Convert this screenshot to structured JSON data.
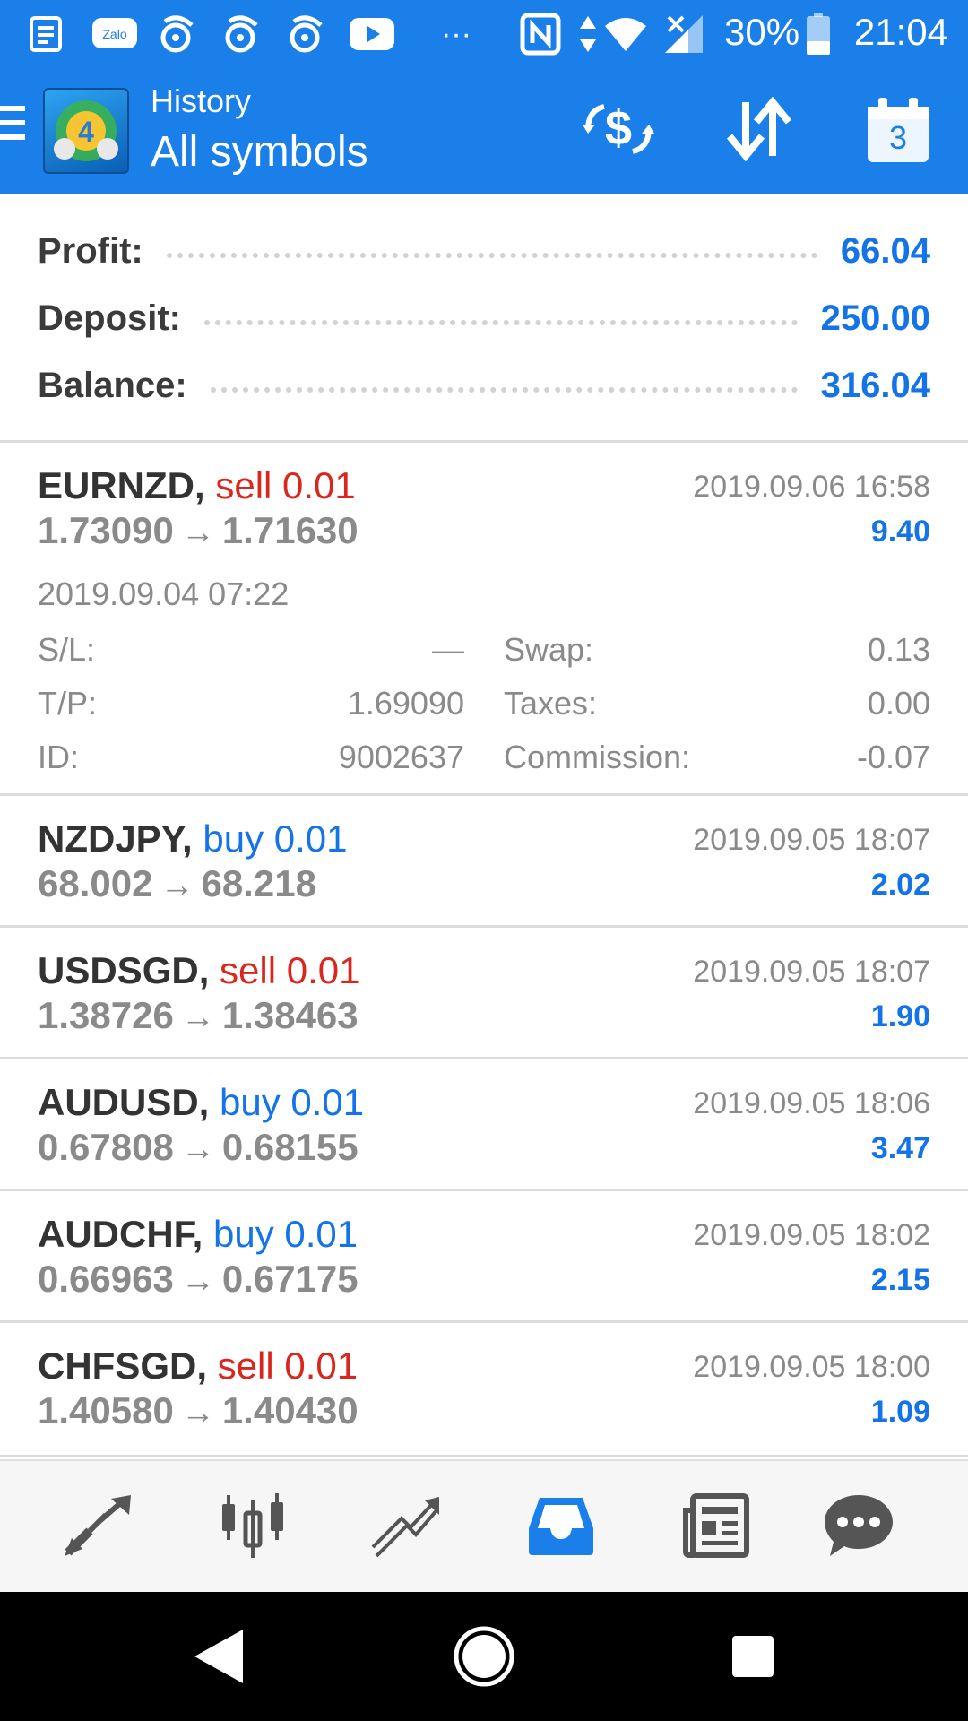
{
  "status_bar": {
    "battery_percent": "30%",
    "time": "21:04",
    "more": "···",
    "zalo": "Zalo"
  },
  "header": {
    "subtitle": "History",
    "title": "All symbols",
    "calendar_day": "3"
  },
  "summary": {
    "profit_label": "Profit:",
    "profit_value": "66.04",
    "deposit_label": "Deposit:",
    "deposit_value": "250.00",
    "balance_label": "Balance:",
    "balance_value": "316.04"
  },
  "trades": [
    {
      "symbol": "EURNZD,",
      "direction": "sell 0.01",
      "direction_type": "sell",
      "open_price": "1.73090",
      "close_price": "1.71630",
      "close_time": "2019.09.06 16:58",
      "profit": "9.40",
      "expanded": true,
      "open_time": "2019.09.04 07:22",
      "sl_label": "S/L:",
      "sl_value": "—",
      "tp_label": "T/P:",
      "tp_value": "1.69090",
      "id_label": "ID:",
      "id_value": "9002637",
      "swap_label": "Swap:",
      "swap_value": "0.13",
      "taxes_label": "Taxes:",
      "taxes_value": "0.00",
      "commission_label": "Commission:",
      "commission_value": "-0.07"
    },
    {
      "symbol": "NZDJPY,",
      "direction": "buy 0.01",
      "direction_type": "buy",
      "open_price": "68.002",
      "close_price": "68.218",
      "close_time": "2019.09.05 18:07",
      "profit": "2.02"
    },
    {
      "symbol": "USDSGD,",
      "direction": "sell 0.01",
      "direction_type": "sell",
      "open_price": "1.38726",
      "close_price": "1.38463",
      "close_time": "2019.09.05 18:07",
      "profit": "1.90"
    },
    {
      "symbol": "AUDUSD,",
      "direction": "buy 0.01",
      "direction_type": "buy",
      "open_price": "0.67808",
      "close_price": "0.68155",
      "close_time": "2019.09.05 18:06",
      "profit": "3.47"
    },
    {
      "symbol": "AUDCHF,",
      "direction": "buy 0.01",
      "direction_type": "buy",
      "open_price": "0.66963",
      "close_price": "0.67175",
      "close_time": "2019.09.05 18:02",
      "profit": "2.15"
    },
    {
      "symbol": "CHFSGD,",
      "direction": "sell 0.01",
      "direction_type": "sell",
      "open_price": "1.40580",
      "close_price": "1.40430",
      "close_time": "2019.09.05 18:00",
      "profit": "1.09"
    }
  ],
  "arrow": "→",
  "bottom_nav": {
    "items": [
      "quotes-icon",
      "chart-icon",
      "trade-icon",
      "history-icon",
      "news-icon",
      "chat-icon"
    ],
    "active": "history-icon"
  },
  "colors": {
    "header_bg": "#1a7fe8",
    "accent_blue": "#1473e6",
    "sell_red": "#d9271d",
    "muted_gray": "#8a8a8a"
  }
}
